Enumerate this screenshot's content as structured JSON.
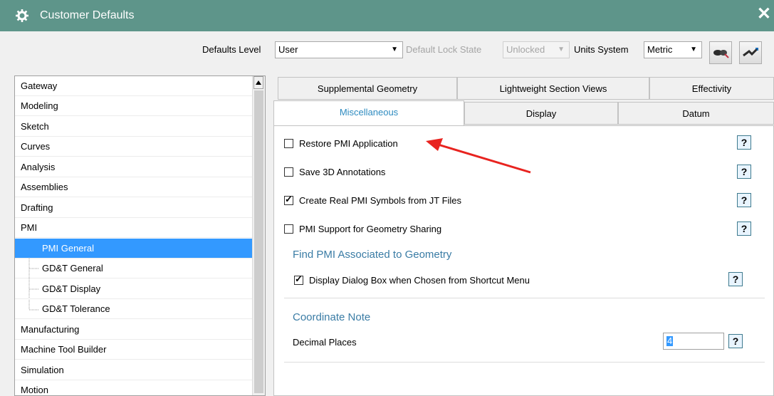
{
  "window": {
    "title": "Customer Defaults",
    "close_glyph": "✕"
  },
  "toolbar": {
    "defaults_level_label": "Defaults Level",
    "defaults_level_value": "User",
    "lock_state_label": "Default Lock State",
    "lock_state_value": "Unlocked",
    "units_label": "Units System",
    "units_value": "Metric",
    "icons": [
      "find-icon",
      "apply-icon"
    ]
  },
  "tree": {
    "items": [
      "Gateway",
      "Modeling",
      "Sketch",
      "Curves",
      "Analysis",
      "Assemblies",
      "Drafting",
      "PMI"
    ],
    "pmi_children": [
      "PMI General",
      "GD&T General",
      "GD&T Display",
      "GD&T Tolerance"
    ],
    "selected_child": "PMI General",
    "after_items": [
      "Manufacturing",
      "Machine Tool Builder",
      "Simulation",
      "Motion"
    ]
  },
  "tabs": {
    "row1": [
      "Supplemental Geometry",
      "Lightweight Section Views",
      "Effectivity"
    ],
    "row2": [
      "Miscellaneous",
      "Display",
      "Datum"
    ],
    "active": "Miscellaneous"
  },
  "options": [
    {
      "label": "Restore PMI Application",
      "checked": false
    },
    {
      "label": "Save 3D Annotations",
      "checked": false
    },
    {
      "label": "Create Real PMI Symbols from JT Files",
      "checked": true
    },
    {
      "label": "PMI Support for Geometry Sharing",
      "checked": false
    }
  ],
  "groups": {
    "find_pmi": {
      "title": "Find PMI Associated to Geometry",
      "option_label": "Display Dialog Box when Chosen from Shortcut Menu",
      "checked": true
    },
    "coord_note": {
      "title": "Coordinate Note",
      "field_label": "Decimal Places",
      "field_value": "4"
    }
  },
  "help_glyph": "?",
  "check_glyph": "✓",
  "annotation_color": "#e8231f",
  "colors": {
    "titlebar": "#5e958a",
    "selection": "#3399ff",
    "group_title": "#3a7ca5"
  }
}
